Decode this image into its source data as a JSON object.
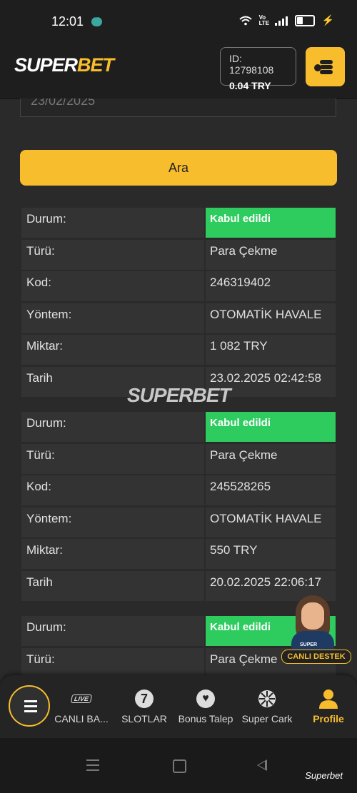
{
  "status_bar": {
    "time": "12:01",
    "network": "Vo LTE"
  },
  "header": {
    "logo_part1": "SUPER",
    "logo_part2": "BET",
    "user_id": "ID: 12798108",
    "balance": "0.04 TRY"
  },
  "search": {
    "date_value": "23/02/2025",
    "button_label": "Ara"
  },
  "labels": {
    "status": "Durum:",
    "type": "Türü:",
    "code": "Kod:",
    "method": "Yöntem:",
    "amount": "Miktar:",
    "date": "Tarih"
  },
  "records": [
    {
      "status": "Kabul edildi",
      "type": "Para Çekme",
      "code": "246319402",
      "method": "OTOMATİK HAVALE",
      "amount": "1 082 TRY",
      "date": "23.02.2025 02:42:58"
    },
    {
      "status": "Kabul edildi",
      "type": "Para Çekme",
      "code": "245528265",
      "method": "OTOMATİK HAVALE",
      "amount": "550 TRY",
      "date": "20.02.2025 22:06:17"
    },
    {
      "status": "Kabul edildi",
      "type": "Para Çekme"
    }
  ],
  "watermark": "SUPERBET",
  "live_support": {
    "badge": "SUPER",
    "label": "CANLI DESTEK"
  },
  "bottom_nav": {
    "live_badge": "LIVE",
    "items": [
      {
        "label": "CANLI BA..."
      },
      {
        "label": "SLOTLAR"
      },
      {
        "label": "Bonus Talep"
      },
      {
        "label": "Super Cark"
      },
      {
        "label": "Profile"
      }
    ]
  },
  "footer_credit": "Superbet",
  "colors": {
    "accent": "#f7bd2c",
    "success": "#2ecc5f",
    "background": "#2a2a2a"
  }
}
